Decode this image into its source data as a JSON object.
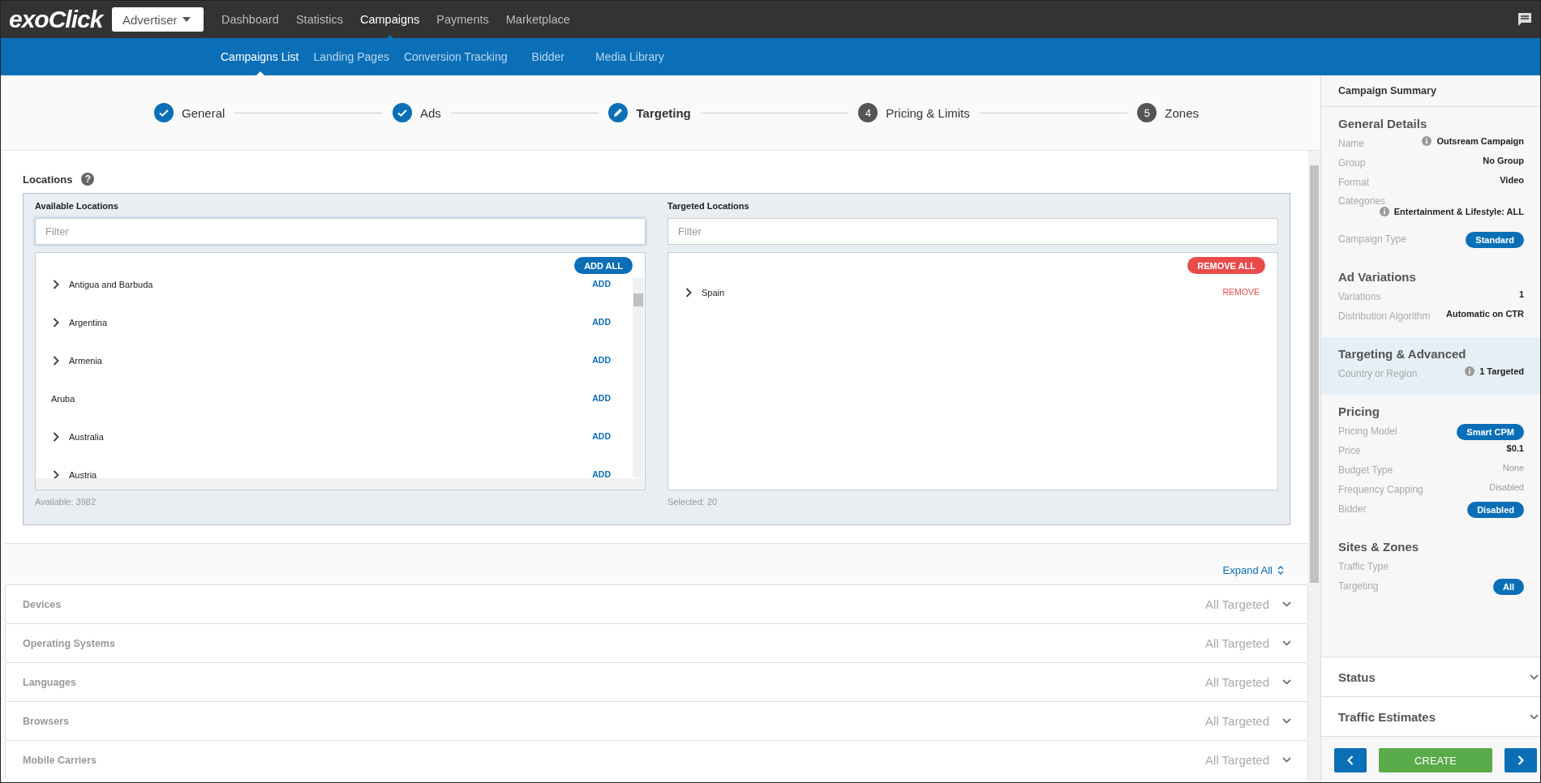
{
  "logo": "exoClick",
  "account_menu": {
    "label": "Advertiser"
  },
  "main_nav": [
    {
      "label": "Dashboard",
      "selected": false
    },
    {
      "label": "Statistics",
      "selected": false
    },
    {
      "label": "Campaigns",
      "selected": true
    },
    {
      "label": "Payments",
      "selected": false
    },
    {
      "label": "Marketplace",
      "selected": false
    }
  ],
  "sub_nav": [
    {
      "label": "Campaigns List",
      "selected": true
    },
    {
      "label": "Landing Pages",
      "selected": false
    },
    {
      "label": "Conversion Tracking",
      "selected": false
    },
    {
      "label": "Bidder",
      "selected": false
    },
    {
      "label": "Media Library",
      "selected": false
    }
  ],
  "steps": [
    {
      "label": "General",
      "completed": true,
      "selected": false
    },
    {
      "label": "Ads",
      "completed": true,
      "selected": false
    },
    {
      "label": "Targeting",
      "completed": false,
      "selected": true
    },
    {
      "label": "Pricing & Limits",
      "completed": false,
      "selected": false,
      "number": "4"
    },
    {
      "label": "Zones",
      "completed": false,
      "selected": false,
      "number": "5"
    }
  ],
  "locations": {
    "title": "Locations",
    "help_glyph": "?",
    "available": {
      "title": "Available Locations",
      "filter_placeholder": "Filter",
      "bulk_label": "ADD ALL",
      "count": "Available: 3982",
      "items": [
        {
          "name": "Antigua and Barbuda",
          "expandable": true,
          "action": "ADD"
        },
        {
          "name": "Argentina",
          "expandable": true,
          "action": "ADD"
        },
        {
          "name": "Armenia",
          "expandable": true,
          "action": "ADD"
        },
        {
          "name": "Aruba",
          "expandable": false,
          "action": "ADD"
        },
        {
          "name": "Australia",
          "expandable": true,
          "action": "ADD"
        },
        {
          "name": "Austria",
          "expandable": true,
          "action": "ADD"
        }
      ]
    },
    "targeted": {
      "title": "Targeted Locations",
      "filter_placeholder": "Filter",
      "bulk_label": "REMOVE ALL",
      "count": "Selected: 20",
      "items": [
        {
          "name": "Spain",
          "expandable": true,
          "action": "REMOVE"
        }
      ]
    }
  },
  "expand_all": "Expand All",
  "targeting_sections": [
    {
      "name": "Devices",
      "status": "All Targeted"
    },
    {
      "name": "Operating Systems",
      "status": "All Targeted"
    },
    {
      "name": "Languages",
      "status": "All Targeted"
    },
    {
      "name": "Browsers",
      "status": "All Targeted"
    },
    {
      "name": "Mobile Carriers",
      "status": "All Targeted"
    }
  ],
  "summary": {
    "title": "Campaign Summary",
    "sections": [
      {
        "title": "General Details",
        "selected": false,
        "rows": [
          {
            "label": "Name",
            "value": "Outsream Campaign",
            "kind": "info"
          },
          {
            "label": "Group",
            "value": "No Group",
            "kind": "text"
          },
          {
            "label": "Format",
            "value": "Video",
            "kind": "text"
          },
          {
            "label": "Categories",
            "value": "Entertainment & Lifestyle: ALL",
            "kind": "info-below"
          },
          {
            "label": "Campaign Type",
            "value": "Standard",
            "kind": "pill"
          }
        ]
      },
      {
        "title": "Ad Variations",
        "selected": false,
        "rows": [
          {
            "label": "Variations",
            "value": "1",
            "kind": "text"
          },
          {
            "label": "Distribution Algorithm",
            "value": "Automatic on CTR",
            "kind": "text"
          }
        ]
      },
      {
        "title": "Targeting & Advanced",
        "selected": true,
        "rows": [
          {
            "label": "Country or Region",
            "value": "1 Targeted",
            "kind": "info"
          }
        ]
      },
      {
        "title": "Pricing",
        "selected": false,
        "rows": [
          {
            "label": "Pricing Model",
            "value": "Smart CPM",
            "kind": "pill"
          },
          {
            "label": "Price",
            "value": "$0.1",
            "kind": "text"
          },
          {
            "label": "Budget Type",
            "value": "None",
            "kind": "muted"
          },
          {
            "label": "Frequency Capping",
            "value": "Disabled",
            "kind": "muted"
          },
          {
            "label": "Bidder",
            "value": "Disabled",
            "kind": "pill"
          }
        ]
      },
      {
        "title": "Sites & Zones",
        "selected": false,
        "rows": [
          {
            "label": "Traffic Type",
            "kind": "text"
          },
          {
            "label": "Targeting",
            "value": "All",
            "kind": "pill"
          }
        ]
      }
    ],
    "panels": [
      {
        "title": "Status"
      },
      {
        "title": "Traffic Estimates"
      }
    ],
    "create_label": "CREATE"
  }
}
